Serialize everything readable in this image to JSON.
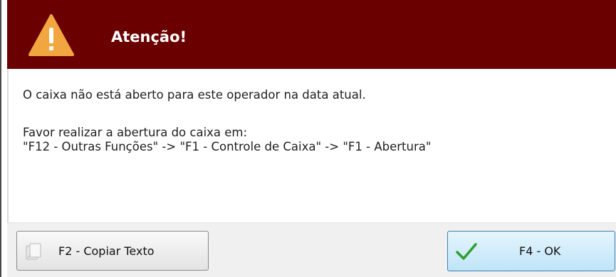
{
  "dialog": {
    "title": "Atenção!",
    "icon": "warning-icon",
    "message_lines": [
      "O caixa não está aberto para este operador na data atual.",
      "Favor realizar a abertura do caixa em:",
      "\"F12 - Outras Funções\" -> \"F1 - Controle de Caixa\" -> \"F1 - Abertura\""
    ],
    "colors": {
      "header_bg": "#6a0000",
      "warning_fill": "#f2a640",
      "ok_button_border": "#3c7fb1",
      "check_green": "#2e9e2e"
    }
  },
  "buttons": {
    "copy": {
      "label": "F2 - Copiar Texto",
      "icon": "document-copy-icon"
    },
    "ok": {
      "label": "F4 - OK",
      "icon": "checkmark-icon"
    }
  }
}
